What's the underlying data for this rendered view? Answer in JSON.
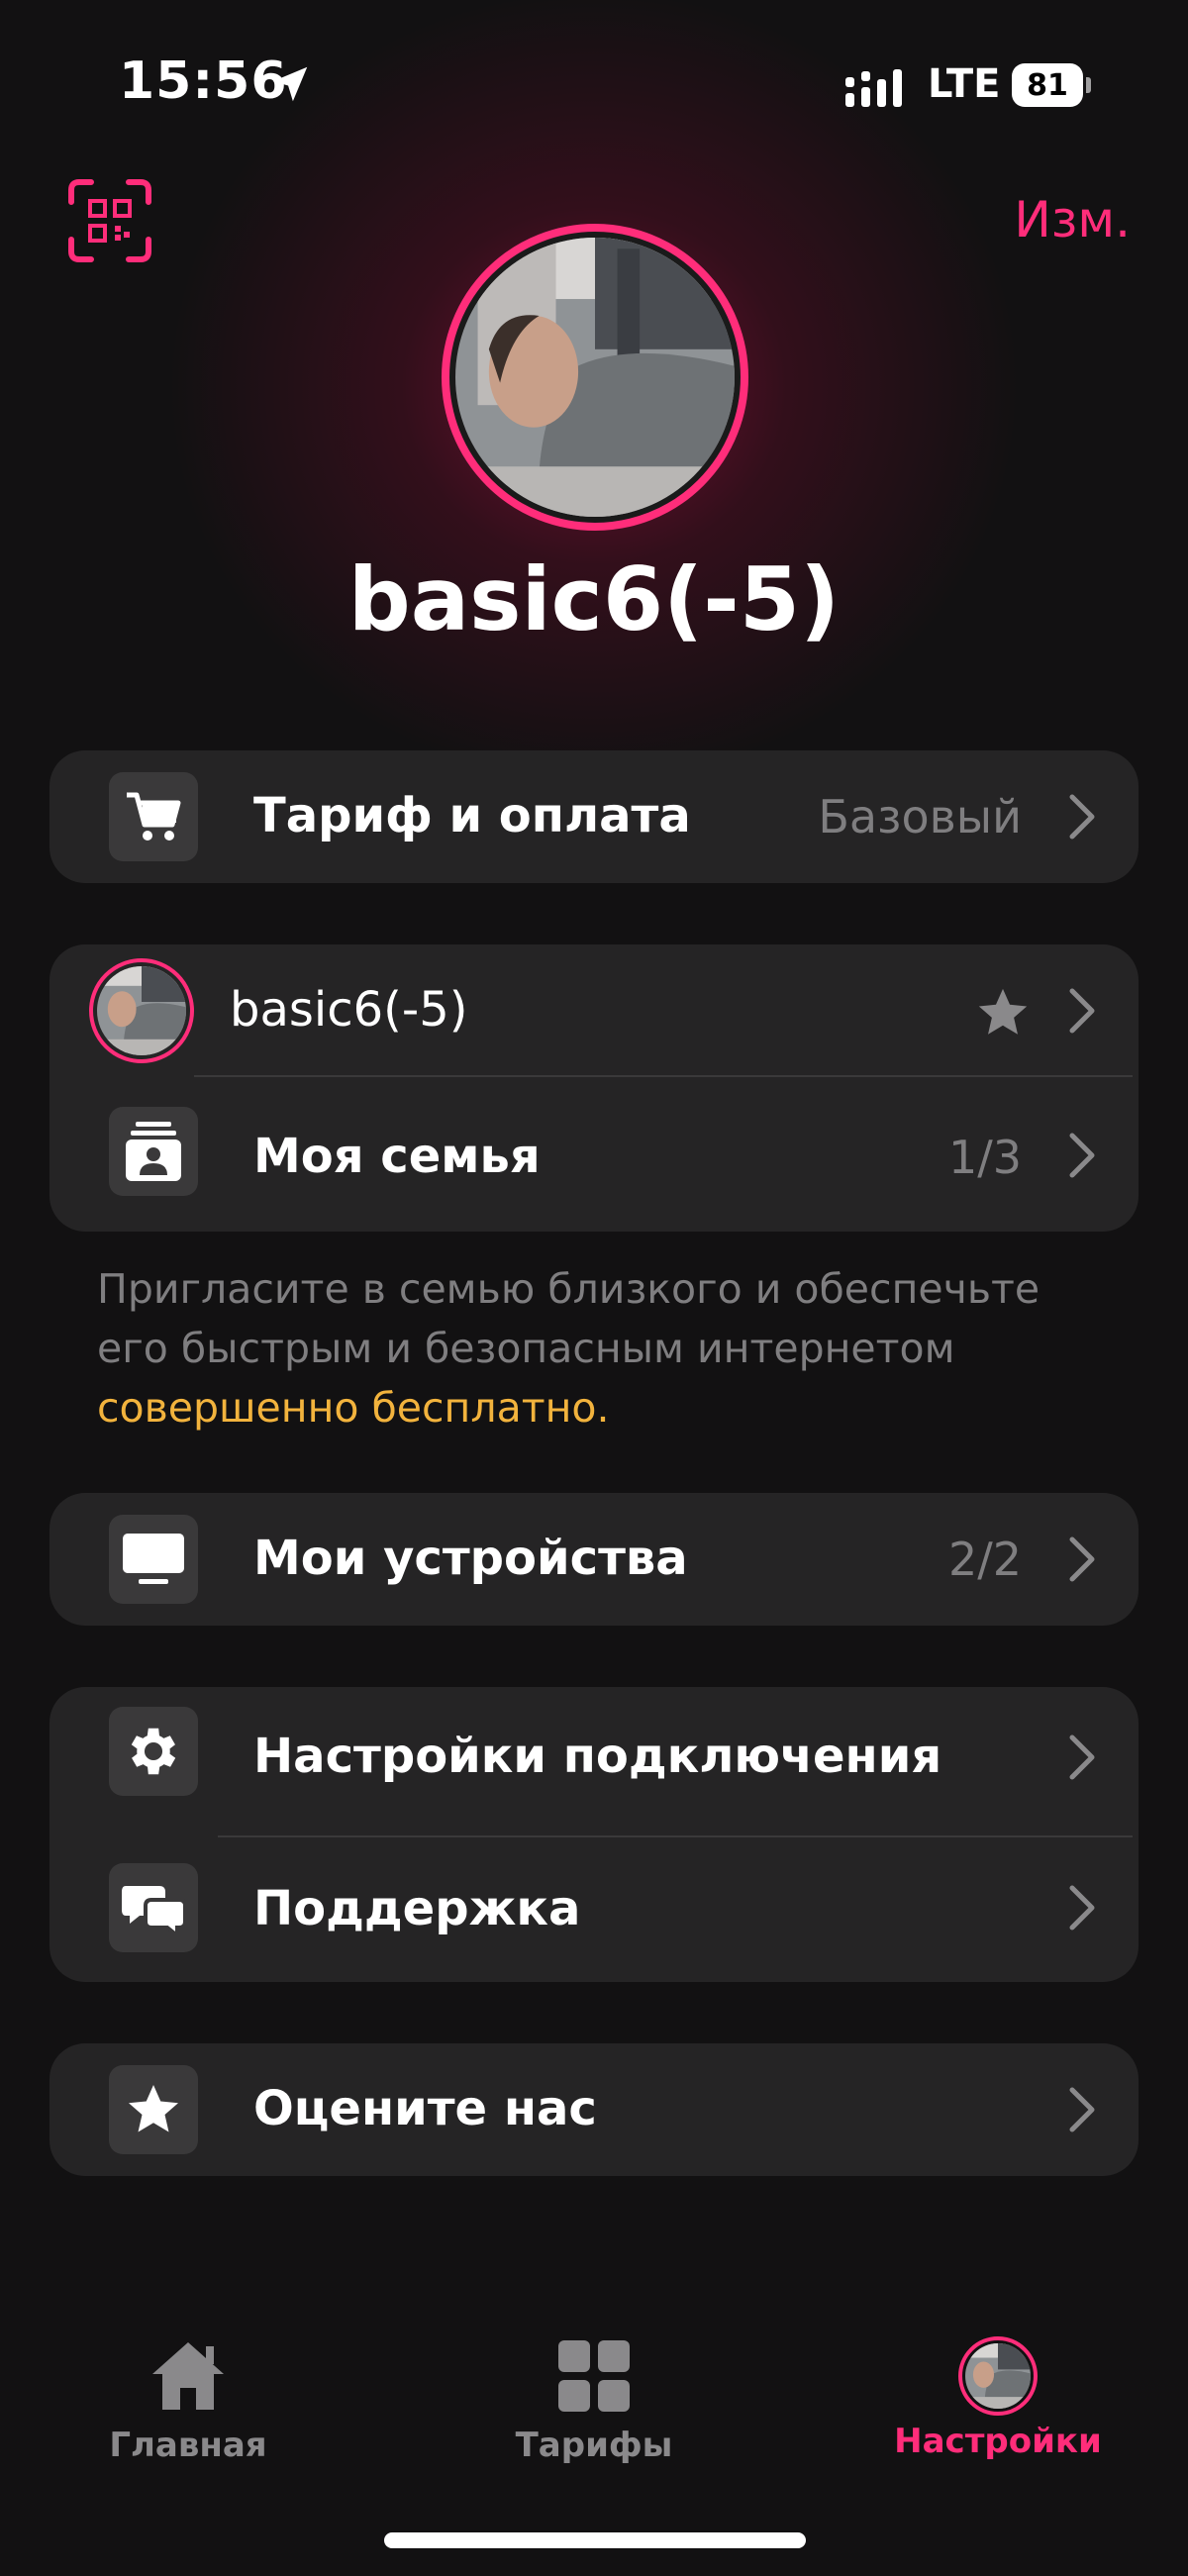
{
  "status_bar": {
    "time": "15:56",
    "network": "LTE",
    "battery": "81"
  },
  "header": {
    "edit_label": "Изм.",
    "profile_name": "basic6(-5)"
  },
  "tariff_card": {
    "label": "Тариф и оплата",
    "value": "Базовый"
  },
  "family_card": {
    "member_name": "basic6(-5)",
    "family_label": "Моя семья",
    "family_value": "1/3"
  },
  "hint": {
    "text": "Пригласите в семью близкого и обеспечьте его быстрым и безопасным интернетом ",
    "link": "совершенно бесплатно."
  },
  "devices_card": {
    "label": "Мои устройства",
    "value": "2/2"
  },
  "settings_card": {
    "connection_label": "Настройки подключения",
    "support_label": "Поддержка"
  },
  "rate_card": {
    "label": "Оцените нас"
  },
  "tab_bar": {
    "tabs": [
      {
        "label": "Главная",
        "icon": "home-icon"
      },
      {
        "label": "Тарифы",
        "icon": "grid-icon"
      },
      {
        "label": "Настройки",
        "icon": "avatar"
      }
    ]
  },
  "colors": {
    "accent": "#ff2d7a",
    "link": "#f2b33d",
    "card": "#252425",
    "background": "#121112"
  }
}
